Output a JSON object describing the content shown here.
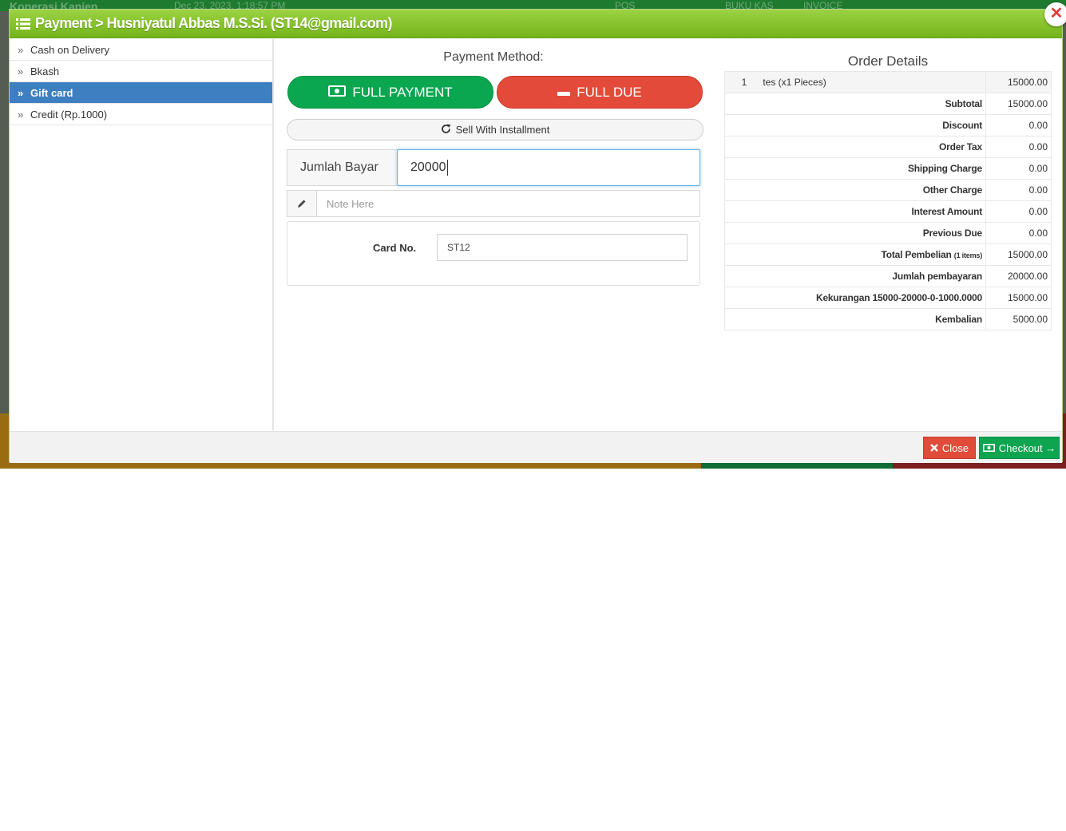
{
  "background": {
    "app_name": "Koperasi Kanjen",
    "datetime": "Dec 23, 2023, 1:18:57 PM",
    "nav_pos": "POS",
    "nav_buku_kas": "BUKU KAS",
    "nav_invoice": "INVOICE"
  },
  "modal": {
    "title": "Payment > Husniyatul Abbas M.S.Si. (ST14@gmail.com)",
    "close_glyph": "✕"
  },
  "sidebar": {
    "items": [
      {
        "label": "Cash on Delivery",
        "active": false
      },
      {
        "label": "Bkash",
        "active": false
      },
      {
        "label": "Gift card",
        "active": true
      },
      {
        "label": "Credit (Rp.1000)",
        "active": false
      }
    ]
  },
  "payment": {
    "method_label": "Payment Method:",
    "full_payment_label": "FULL PAYMENT",
    "full_due_label": "FULL DUE",
    "installment_label": "Sell With Installment",
    "amount_label": "Jumlah Bayar",
    "amount_value": "20000",
    "note_placeholder": "Note Here",
    "card_label": "Card No.",
    "card_value": "ST12"
  },
  "order": {
    "title": "Order Details",
    "item_no": "1",
    "item_name": "tes (x1 Pieces)",
    "item_price": "15000.00",
    "rows": [
      {
        "label": "Subtotal",
        "value": "15000.00"
      },
      {
        "label": "Discount",
        "value": "0.00"
      },
      {
        "label": "Order Tax",
        "value": "0.00"
      },
      {
        "label": "Shipping Charge",
        "value": "0.00"
      },
      {
        "label": "Other Charge",
        "value": "0.00"
      },
      {
        "label": "Interest Amount",
        "value": "0.00"
      },
      {
        "label": "Previous Due",
        "value": "0.00"
      },
      {
        "label": "Total Pembelian",
        "suffix": "(1 items)",
        "value": "15000.00"
      },
      {
        "label": "Jumlah pembayaran",
        "value": "20000.00"
      },
      {
        "label": "Kekurangan 15000-20000-0-1000.0000",
        "value": "15000.00"
      },
      {
        "label": "Kembalian",
        "value": "5000.00"
      }
    ]
  },
  "footer": {
    "close_label": "Close",
    "checkout_label": "Checkout →"
  },
  "colors": {
    "header_green": "#8cc63f",
    "active_blue": "#3d7fc1",
    "full_payment_green": "#0aa650",
    "full_due_red": "#e34a3a",
    "checkout_green": "#0ea551",
    "close_red": "#e04b3a"
  },
  "icons": {
    "header": "list-icon",
    "full_payment": "money-icon",
    "full_due": "minus-icon",
    "installment": "refresh-icon",
    "note": "pencil-icon",
    "close": "times-icon",
    "checkout": "money-icon"
  }
}
